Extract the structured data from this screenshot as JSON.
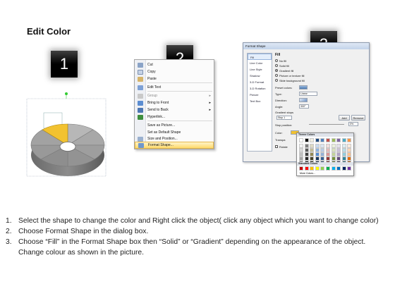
{
  "page_title": "Edit Color",
  "steps": [
    "1",
    "2",
    "3"
  ],
  "context_menu": {
    "items": [
      {
        "label": "Cut",
        "icon": "scissors-icon"
      },
      {
        "label": "Copy",
        "icon": "copy-icon"
      },
      {
        "label": "Paste",
        "icon": "paste-icon"
      },
      {
        "label": "Edit Text",
        "icon": "edit-text-icon"
      },
      {
        "label": "Group",
        "icon": "group-icon"
      },
      {
        "label": "Bring to Front",
        "icon": "bring-front-icon"
      },
      {
        "label": "Send to Back",
        "icon": "send-back-icon"
      },
      {
        "label": "Hyperlink...",
        "icon": "hyperlink-icon"
      },
      {
        "label": "Save as Picture...",
        "icon": ""
      },
      {
        "label": "Set as Default Shape",
        "icon": ""
      },
      {
        "label": "Size and Position...",
        "icon": "size-icon"
      },
      {
        "label": "Format Shape...",
        "icon": "format-shape-icon"
      }
    ]
  },
  "format_dialog": {
    "title": "Format Shape",
    "categories": [
      "Fill",
      "Line Color",
      "Line Style",
      "Shadow",
      "3-D Format",
      "3-D Rotation",
      "Picture",
      "Text Box"
    ],
    "section": "Fill",
    "options": [
      "No fill",
      "Solid fill",
      "Gradient fill",
      "Picture or texture fill",
      "Slide background fill"
    ],
    "preset_colors_label": "Preset colors:",
    "type_label": "Type:",
    "type_value": "Linear",
    "direction_label": "Direction:",
    "angle_label": "Angle:",
    "angle_value": "300°",
    "gradient_stops_label": "Gradient stops",
    "stop_value": "Stop 1",
    "add_label": "Add",
    "remove_label": "Remove",
    "stop_position_label": "Stop position:",
    "stop_position_value": "0%",
    "color_label": "Color:",
    "transparency_label": "Transpa",
    "rotate_label": "Rotate"
  },
  "color_palette": {
    "theme_label": "Theme Colors",
    "standard_label": "Standard Colors",
    "more_label": "More Colors...",
    "theme_top": [
      "#ffffff",
      "#000000",
      "#eeece1",
      "#1f497d",
      "#4f81bd",
      "#c0504d",
      "#9bbb59",
      "#8064a2",
      "#4bacc6",
      "#f79646"
    ],
    "theme_shades": [
      [
        "#f2f2f2",
        "#7f7f7f",
        "#ddd9c3",
        "#c6d9f0",
        "#dbe5f1",
        "#f2dcdb",
        "#ebf1dd",
        "#e5e0ec",
        "#dbeef3",
        "#fdeada"
      ],
      [
        "#d8d8d8",
        "#595959",
        "#c4bd97",
        "#8db3e2",
        "#b8cce4",
        "#e5b9b7",
        "#d7e3bc",
        "#ccc1d9",
        "#b7dde8",
        "#fbd5b5"
      ],
      [
        "#bfbfbf",
        "#3f3f3f",
        "#938953",
        "#548dd4",
        "#95b3d7",
        "#d99694",
        "#c3d69b",
        "#b2a2c7",
        "#92cddc",
        "#fac08f"
      ],
      [
        "#a5a5a5",
        "#262626",
        "#494429",
        "#17365d",
        "#366092",
        "#953734",
        "#76923c",
        "#5f497a",
        "#31859b",
        "#e36c09"
      ],
      [
        "#7f7f7f",
        "#0c0c0c",
        "#1d1b10",
        "#0f243e",
        "#244061",
        "#632423",
        "#4f6128",
        "#3f3151",
        "#205867",
        "#974806"
      ]
    ],
    "standard": [
      "#c00000",
      "#ff0000",
      "#ffc000",
      "#ffff00",
      "#92d050",
      "#00b050",
      "#00b0f0",
      "#0070c0",
      "#002060",
      "#7030a0"
    ]
  },
  "instructions": [
    {
      "num": "1.",
      "text": "Select the shape to change the color and Right click the object( click any object which you want to change color)"
    },
    {
      "num": "2.",
      "text": "Choose Format Shape in the dialog box."
    },
    {
      "num": "3.",
      "text": "Choose “Fill” in the Format Shape box then “Solid” or “Gradient” depending on the appearance of the object. Change colour as shown in the picture."
    }
  ],
  "colors": {
    "highlight_segment": "#f2c230",
    "segment_gray": "#9a9a9a",
    "menu_highlight": "#ffd96b"
  }
}
